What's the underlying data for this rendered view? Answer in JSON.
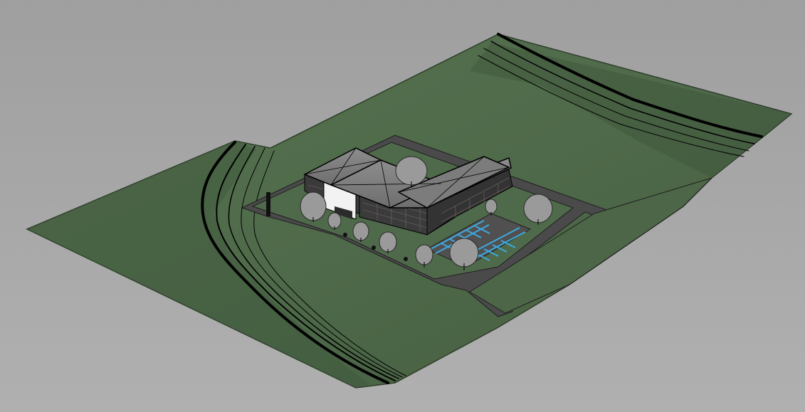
{
  "viewport": {
    "title": "",
    "background_color": "#a6a6a6",
    "view_type": "3D perspective site model",
    "colors": {
      "terrain": "#4f6a4a",
      "terrain_shadow": "#3e5539",
      "road": "#4a4a4a",
      "building_wall": "#3a3a3a",
      "building_roof": "#7f7f7f",
      "entrance_white": "#f2f2f2",
      "parking_stripes": "#3fa9e0",
      "tree_foliage": "#9a9a9a",
      "contour_line": "#000000"
    },
    "icons": {
      "tree": "tree-icon",
      "building": "building-icon",
      "parking": "parking-icon"
    }
  }
}
